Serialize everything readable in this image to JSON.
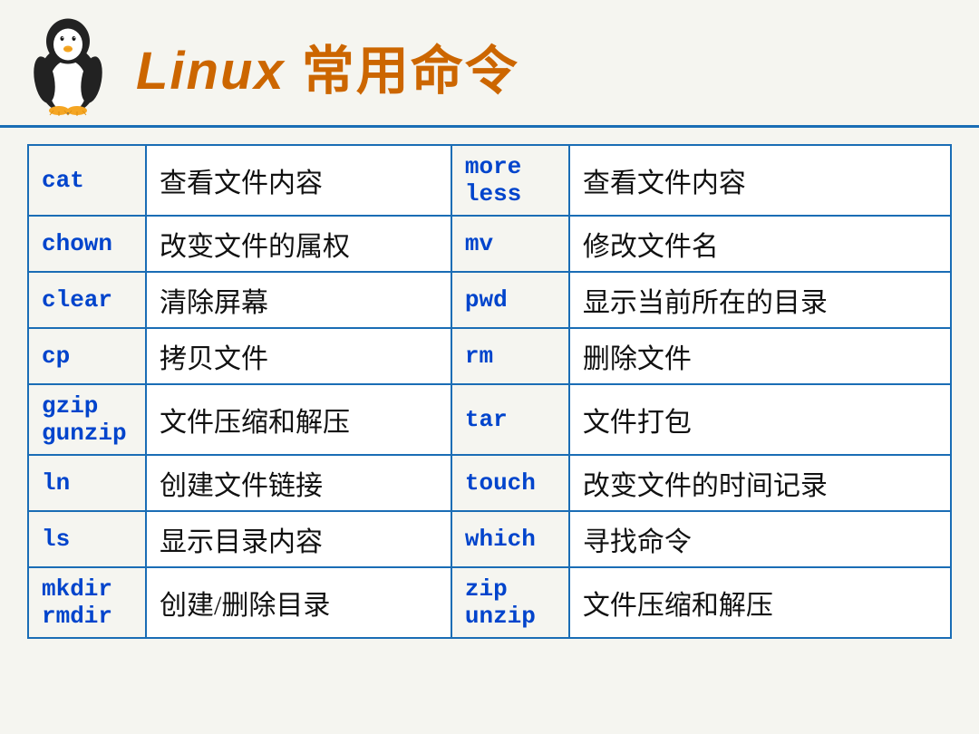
{
  "header": {
    "title_part1": "Linux",
    "title_part2": " 常用命令"
  },
  "table": {
    "rows": [
      {
        "cmd_left": "cat",
        "desc_left": "查看文件内容",
        "cmd_right": "more\nless",
        "desc_right": "查看文件内容"
      },
      {
        "cmd_left": "chown",
        "desc_left": "改变文件的属权",
        "cmd_right": "mv",
        "desc_right": "修改文件名"
      },
      {
        "cmd_left": "clear",
        "desc_left": "清除屏幕",
        "cmd_right": "pwd",
        "desc_right": "显示当前所在的目录"
      },
      {
        "cmd_left": "cp",
        "desc_left": "拷贝文件",
        "cmd_right": "rm",
        "desc_right": "删除文件"
      },
      {
        "cmd_left": "gzip\ngunzip",
        "desc_left": "文件压缩和解压",
        "cmd_right": "tar",
        "desc_right": "文件打包"
      },
      {
        "cmd_left": "ln",
        "desc_left": "创建文件链接",
        "cmd_right": "touch",
        "desc_right": "改变文件的时间记录"
      },
      {
        "cmd_left": "ls",
        "desc_left": "显示目录内容",
        "cmd_right": "which",
        "desc_right": "寻找命令"
      },
      {
        "cmd_left": "mkdir\nrmdir",
        "desc_left": "创建/删除目录",
        "cmd_right": "zip\nunzip",
        "desc_right": "文件压缩和解压"
      }
    ]
  }
}
